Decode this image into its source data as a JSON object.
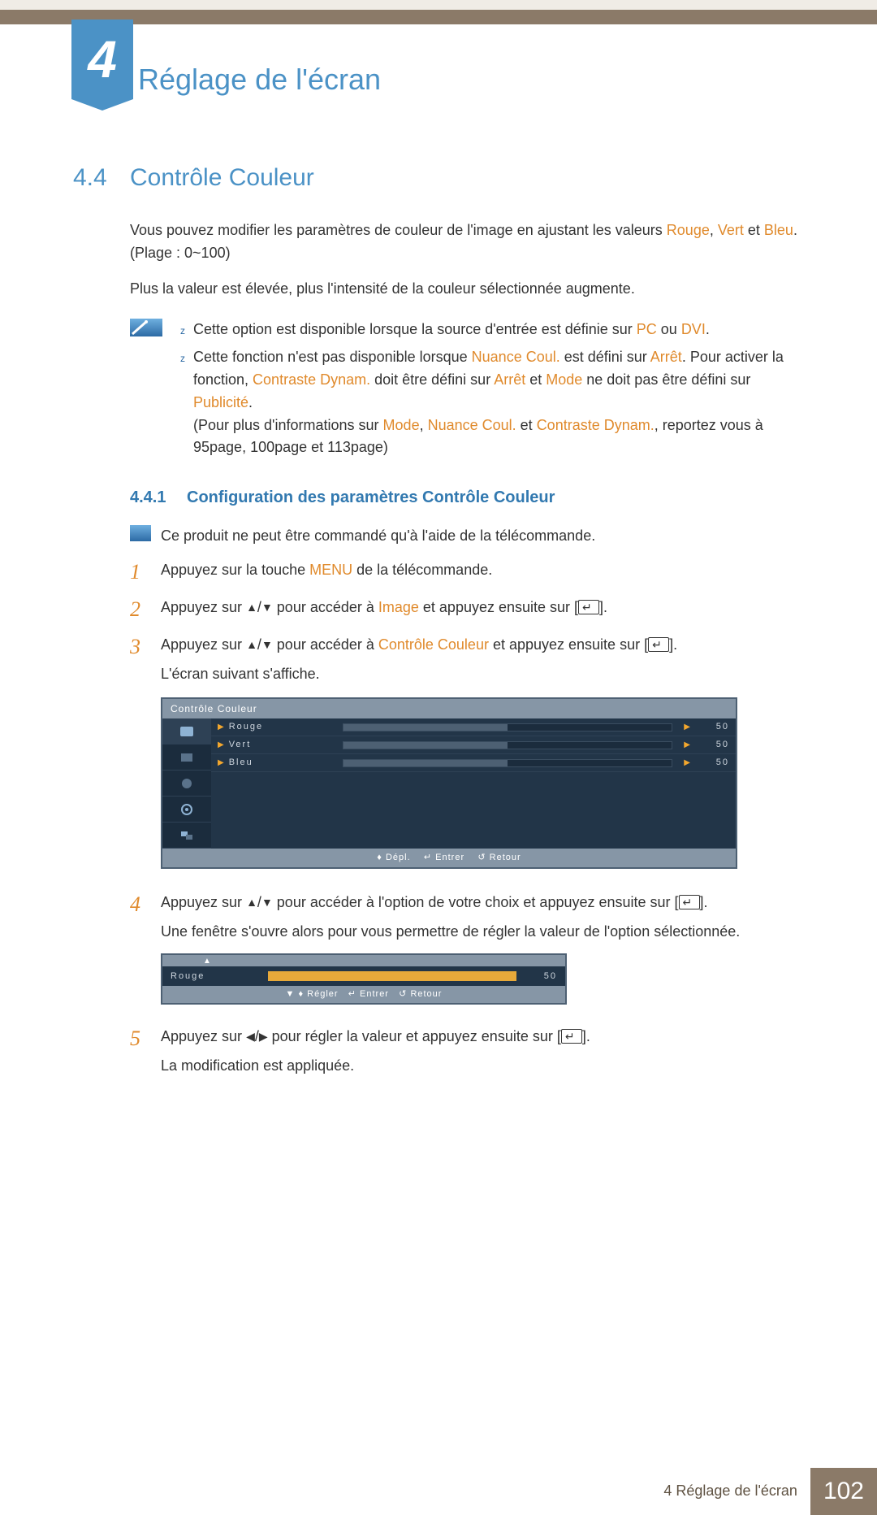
{
  "chapter": {
    "number": "4",
    "title": "Réglage de l'écran"
  },
  "section": {
    "number": "4.4",
    "title": "Contrôle Couleur"
  },
  "intro": {
    "p1_a": "Vous pouvez modifier les paramètres de couleur de l'image en ajustant les valeurs ",
    "rouge": "Rouge",
    "sep1": ", ",
    "vert": "Vert",
    "sep2": " et ",
    "bleu": "Bleu",
    "p1_b": ". (Plage : 0~100)",
    "p2": "Plus la valeur est élevée, plus l'intensité de la couleur sélectionnée augmente."
  },
  "notes": {
    "n1_a": "Cette option est disponible lorsque la source d'entrée est définie sur ",
    "pc": "PC",
    "or": " ou ",
    "dvi": "DVI",
    "dot": ".",
    "n2_a": "Cette fonction n'est pas disponible lorsque ",
    "nuance": "Nuance Coul.",
    "n2_b": " est défini sur ",
    "arret": "Arrêt",
    "n2_c": ". Pour activer la fonction, ",
    "cdyn": "Contraste Dynam.",
    "n2_d": " doit être défini sur ",
    "arret2": "Arrêt",
    "n2_e": " et ",
    "mode": "Mode",
    "n2_f": " ne doit pas être défini sur ",
    "pub": "Publicité",
    "dot2": ".",
    "n3_a": "(Pour plus d'informations sur ",
    "mode2": "Mode",
    "c1": ", ",
    "nuance2": "Nuance Coul.",
    "c2": " et ",
    "cdyn2": "Contraste Dynam.",
    "n3_b": ", reportez vous à 95page, 100page et 113page)"
  },
  "subsection": {
    "number": "4.4.1",
    "title": "Configuration des paramètres Contrôle Couleur"
  },
  "remote_only": "Ce produit ne peut être commandé qu'à l'aide de la télécommande.",
  "steps": {
    "s1_a": "Appuyez sur la touche ",
    "menu": "MENU",
    "s1_b": " de la télécommande.",
    "s2_a": "Appuyez sur ",
    "s2_b": " pour accéder à ",
    "image": "Image",
    "s2_c": " et appuyez ensuite sur [",
    "s2_d": "].",
    "s3_a": "Appuyez sur ",
    "s3_b": " pour accéder à ",
    "cc": "Contrôle Couleur",
    "s3_c": " et appuyez ensuite sur [",
    "s3_d": "].",
    "s3_e": "L'écran suivant s'affiche.",
    "s4_a": "Appuyez sur ",
    "s4_b": " pour accéder à l'option de votre choix et appuyez ensuite sur [",
    "s4_c": "].",
    "s4_d": "Une fenêtre s'ouvre alors pour vous permettre de régler la valeur de l'option sélectionnée.",
    "s5_a": "Appuyez sur ",
    "s5_b": " pour régler la valeur et appuyez ensuite sur [",
    "s5_c": "].",
    "s5_d": "La modification est appliquée."
  },
  "osd": {
    "title": "Contrôle Couleur",
    "rows": [
      {
        "label": "Rouge",
        "value": "50"
      },
      {
        "label": "Vert",
        "value": "50"
      },
      {
        "label": "Bleu",
        "value": "50"
      }
    ],
    "footer_move": "Dépl.",
    "footer_enter": "Entrer",
    "footer_return": "Retour"
  },
  "slider": {
    "label": "Rouge",
    "value": "50",
    "footer_adjust": "Régler",
    "footer_enter": "Entrer",
    "footer_return": "Retour"
  },
  "footer": {
    "chapter_label": "4 Réglage de l'écran",
    "page": "102"
  }
}
